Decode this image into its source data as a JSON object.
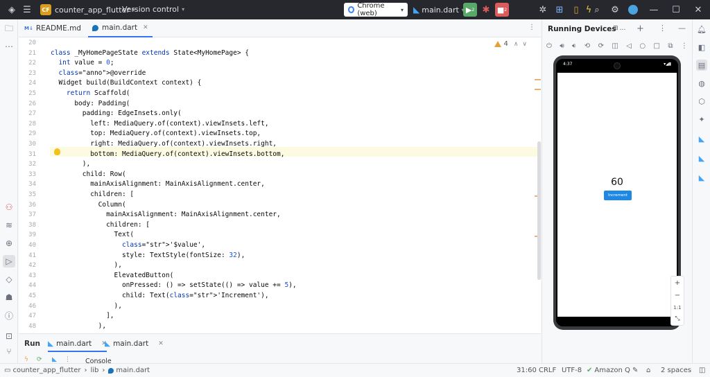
{
  "topbar": {
    "project_badge": "CF",
    "project_name": "counter_app_flutter",
    "vcs": "Version control",
    "device": "Chrome (web)",
    "run_config": "main.dart",
    "debug_badge": "2",
    "stop_badge": "2"
  },
  "tabs": [
    {
      "label": "README.md",
      "icon": "M↓"
    },
    {
      "label": "main.dart",
      "icon": "dart"
    }
  ],
  "editor": {
    "warnings": "4",
    "caret_line": 31,
    "lines": [
      {
        "n": "20",
        "t": ""
      },
      {
        "n": "21",
        "t": "class _MyHomePageState extends State<MyHomePage> {"
      },
      {
        "n": "22",
        "t": "  int value = 0;"
      },
      {
        "n": "23",
        "t": "  @override"
      },
      {
        "n": "24",
        "t": "  Widget build(BuildContext context) {"
      },
      {
        "n": "25",
        "t": "    return Scaffold("
      },
      {
        "n": "26",
        "t": "      body: Padding("
      },
      {
        "n": "27",
        "t": "        padding: EdgeInsets.only("
      },
      {
        "n": "28",
        "t": "          left: MediaQuery.of(context).viewInsets.left,"
      },
      {
        "n": "29",
        "t": "          top: MediaQuery.of(context).viewInsets.top,"
      },
      {
        "n": "30",
        "t": "          right: MediaQuery.of(context).viewInsets.right,"
      },
      {
        "n": "31",
        "t": "          bottom: MediaQuery.of(context).viewInsets.bottom,"
      },
      {
        "n": "32",
        "t": "        ),"
      },
      {
        "n": "33",
        "t": "        child: Row("
      },
      {
        "n": "34",
        "t": "          mainAxisAlignment: MainAxisAlignment.center,"
      },
      {
        "n": "35",
        "t": "          children: ["
      },
      {
        "n": "36",
        "t": "            Column("
      },
      {
        "n": "37",
        "t": "              mainAxisAlignment: MainAxisAlignment.center,"
      },
      {
        "n": "38",
        "t": "              children: ["
      },
      {
        "n": "39",
        "t": "                Text("
      },
      {
        "n": "40",
        "t": "                  '$value',"
      },
      {
        "n": "41",
        "t": "                  style: TextStyle(fontSize: 32),"
      },
      {
        "n": "42",
        "t": "                ),"
      },
      {
        "n": "43",
        "t": "                ElevatedButton("
      },
      {
        "n": "44",
        "t": "                  onPressed: () => setState(() => value += 5),"
      },
      {
        "n": "45",
        "t": "                  child: Text('Increment'),"
      },
      {
        "n": "46",
        "t": "                ),"
      },
      {
        "n": "47",
        "t": "              ],"
      },
      {
        "n": "48",
        "t": "            ),"
      }
    ]
  },
  "devices": {
    "title": "Running Devices",
    "tab_label": "…",
    "status_time": "4:37",
    "counter": "60",
    "button": "Increment",
    "zoom_label": "1:1"
  },
  "runpanel": {
    "run_label": "Run",
    "tab1": "main.dart",
    "tab2": "main.dart",
    "console": "Console"
  },
  "statusbar": {
    "path_project": "counter_app_flutter",
    "path_lib": "lib",
    "path_file": "main.dart",
    "position": "31:60",
    "line_sep": "CRLF",
    "encoding": "UTF-8",
    "assistant": "Amazon Q",
    "indent": "2 spaces"
  },
  "colors": {
    "accent": "#3574f0",
    "run_green": "#59a869",
    "stop_red": "#db5c5c",
    "flutter_blue": "#1e88e5"
  }
}
